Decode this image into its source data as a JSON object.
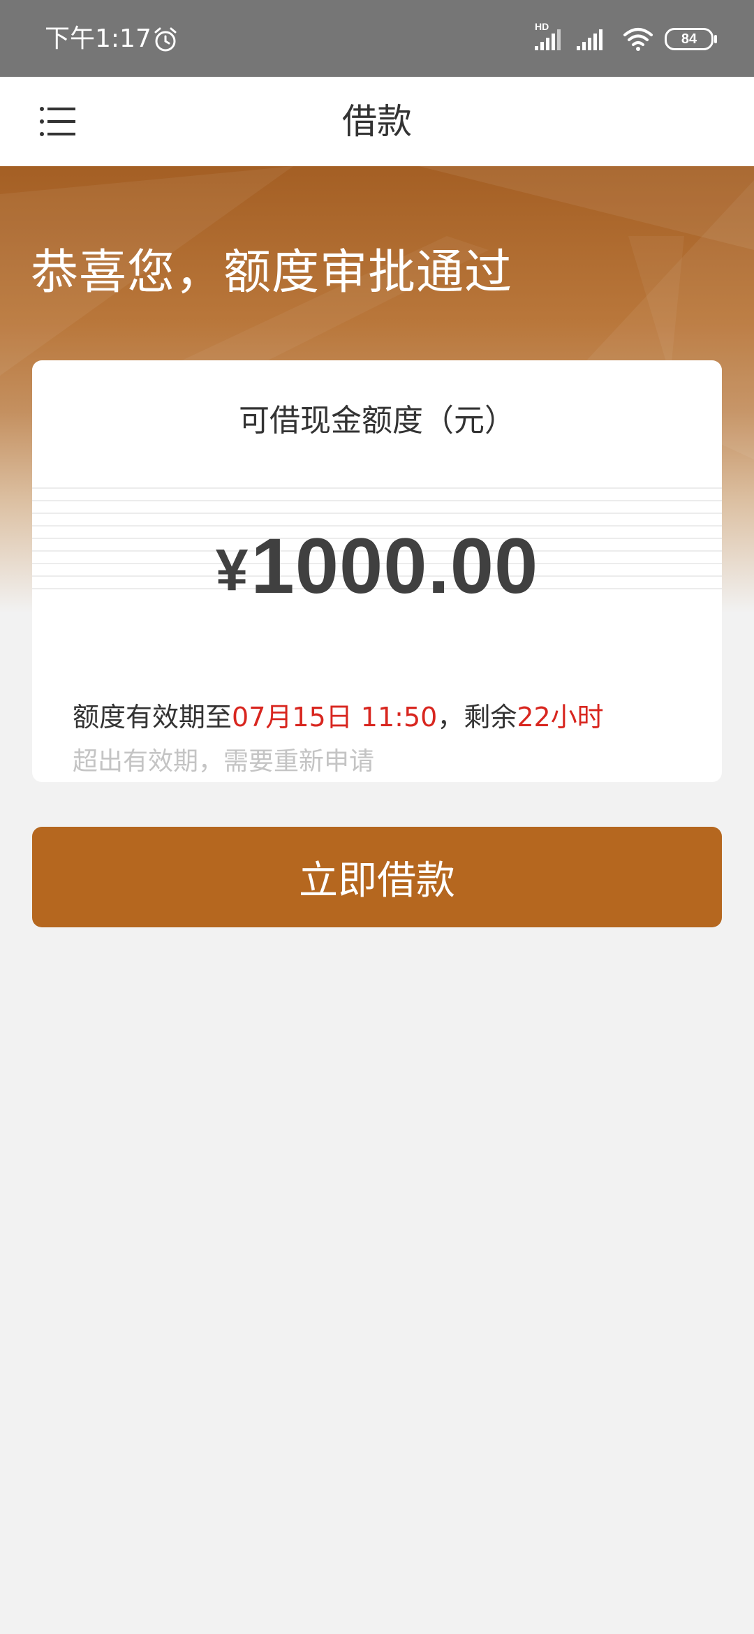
{
  "status_bar": {
    "time": "下午1:17",
    "network_badge": "HD",
    "battery_level": "84",
    "icons": [
      "alarm-icon",
      "signal-icon",
      "signal-icon",
      "wifi-icon",
      "battery-icon"
    ]
  },
  "header": {
    "title": "借款",
    "menu_icon": "menu-icon"
  },
  "banner": {
    "title": "恭喜您，额度审批通过"
  },
  "card": {
    "label": "可借现金额度（元）",
    "currency": "¥",
    "amount": "1000.00",
    "validity": {
      "prefix": "额度有效期至",
      "date": "07月15日 11:50",
      "middle": "，剩余",
      "remaining": "22小时"
    },
    "hint": "超出有效期，需要重新申请"
  },
  "actions": {
    "borrow_label": "立即借款"
  },
  "colors": {
    "brand": "#b5671f",
    "highlight_red": "#d8261f",
    "status_bar": "#767676"
  }
}
